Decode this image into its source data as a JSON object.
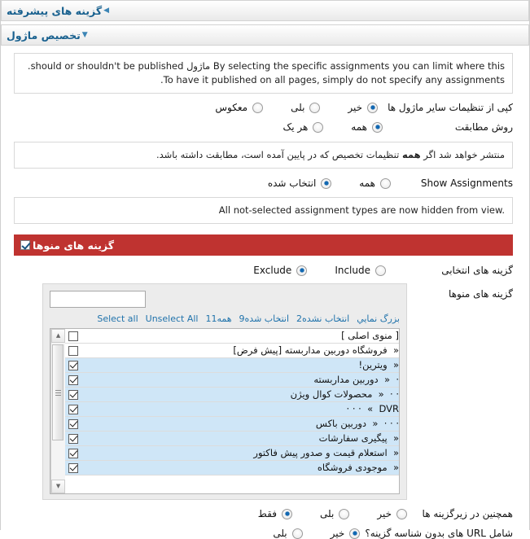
{
  "panels": {
    "advanced": {
      "title": "گزینه های پیشرفته",
      "arrow": "◀",
      "state": "collapsed"
    },
    "module_assignment": {
      "title": "تخصیص ماژول",
      "arrow": "▼",
      "state": "expanded"
    }
  },
  "notes": {
    "assignment_help_line1": "By selecting the specific assignments you can limit where this ماژول should or shouldn't be published.",
    "assignment_help_line2": "To have it published on all pages, simply do not specify any assignments.",
    "match_method_note_prefix": "منتشر خواهد شد اگر ",
    "match_method_note_bold": "همه",
    "match_method_note_suffix": " تنظیمات تخصیص که در پایین آمده است، مطابقت داشته باشد.",
    "show_assignments_note": "All not-selected assignment types are now hidden from view."
  },
  "rows": {
    "copy_settings": {
      "label": "کپی از تنظیمات سایر ماژول ها",
      "options": [
        {
          "label": "خیر",
          "selected": true
        },
        {
          "label": "بلی",
          "selected": false
        },
        {
          "label": "معکوس",
          "selected": false
        }
      ]
    },
    "match_method": {
      "label": "روش مطابقت",
      "options": [
        {
          "label": "همه",
          "selected": true
        },
        {
          "label": "هر یک",
          "selected": false
        }
      ]
    },
    "show_assignments": {
      "label": "Show Assignments",
      "options": [
        {
          "label": "همه",
          "selected": false
        },
        {
          "label": "انتخاب شده",
          "selected": true
        }
      ]
    },
    "selected_options": {
      "label": "گزینه های انتخابی",
      "options": [
        {
          "label": "Include",
          "selected": false
        },
        {
          "label": "Exclude",
          "selected": true
        }
      ]
    },
    "menu_options": {
      "label": "گزینه های منوها"
    },
    "include_subitems": {
      "label": "همچنین در زیرگزینه ها",
      "options": [
        {
          "label": "خیر",
          "selected": false
        },
        {
          "label": "بلی",
          "selected": false
        },
        {
          "label": "فقط",
          "selected": true
        }
      ]
    },
    "include_no_itemid_urls": {
      "label": "شامل URL های بدون شناسه گزینه؟",
      "options": [
        {
          "label": "خیر",
          "selected": true
        },
        {
          "label": "بلی",
          "selected": false
        }
      ]
    }
  },
  "menu_options_bar": {
    "title": "گزینه های منوها",
    "checked": true,
    "color": "#bf3330"
  },
  "picker": {
    "search_value": "",
    "search_placeholder": "",
    "toolbar": [
      {
        "label": "Select all"
      },
      {
        "label": "Unselect All"
      },
      {
        "label": "همه11"
      },
      {
        "label": "انتخاب شده9"
      },
      {
        "label": "انتخاب نشده2"
      },
      {
        "label": "بزرگ نمايي"
      }
    ],
    "scrollbar": {
      "up": "▲",
      "down": "▼"
    },
    "items": [
      {
        "dots": "",
        "chev": "",
        "label": "[ منوی اصلی ]",
        "checked": false,
        "selected": false
      },
      {
        "dots": "",
        "chev": "«",
        "label": "فروشگاه دوربین مداربسته [پیش فرض]",
        "checked": false,
        "selected": false
      },
      {
        "dots": "",
        "chev": "«",
        "label": "ویترین!",
        "checked": true,
        "selected": true
      },
      {
        "dots": "·",
        "chev": "«",
        "label": "دوربین مداربسته",
        "checked": true,
        "selected": true
      },
      {
        "dots": "· ·",
        "chev": "«",
        "label": "محصولات کوال ویژن",
        "checked": true,
        "selected": true
      },
      {
        "dots": "· · ·",
        "chev": "«",
        "label": "DVR",
        "checked": true,
        "selected": true
      },
      {
        "dots": "· · ·",
        "chev": "«",
        "label": "دوربین باکس",
        "checked": true,
        "selected": true
      },
      {
        "dots": "",
        "chev": "«",
        "label": "پیگیری سفارشات",
        "checked": true,
        "selected": true
      },
      {
        "dots": "",
        "chev": "«",
        "label": "استعلام قیمت و صدور پیش فاکتور",
        "checked": true,
        "selected": true
      },
      {
        "dots": "",
        "chev": "«",
        "label": "موجودی فروشگاه",
        "checked": true,
        "selected": true
      }
    ]
  }
}
